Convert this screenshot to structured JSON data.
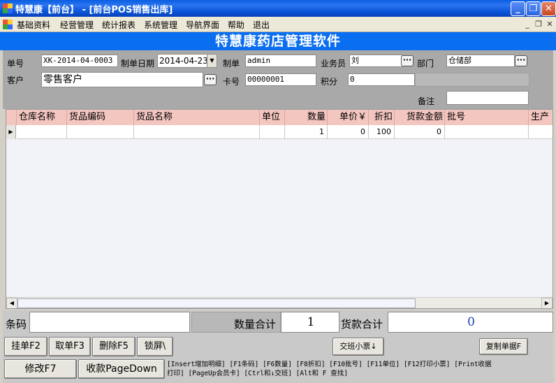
{
  "window": {
    "title": "特慧康【前台】 - [前台POS销售出库]"
  },
  "menu": {
    "items": [
      "基础资料",
      "经营管理",
      "统计报表",
      "系统管理",
      "导航界面",
      "帮助",
      "退出"
    ]
  },
  "banner": {
    "title": "特慧康药店管理软件"
  },
  "form": {
    "order_no_label": "单号",
    "order_no": "XK-2014-04-0003",
    "date_label": "制单日期",
    "date": "2014-04-23",
    "maker_label": "制单",
    "maker": "admin",
    "salesman_label": "业务员",
    "salesman": "刘",
    "dept_label": "部门",
    "dept": "仓储部",
    "customer_label": "客户",
    "customer": "零售客户",
    "card_label": "卡号",
    "card": "00000001",
    "points_label": "积分",
    "points": "0",
    "remark_label": "备注",
    "remark": ""
  },
  "grid": {
    "columns": [
      "仓库名称",
      "货品编码",
      "货品名称",
      "单位",
      "数量",
      "单价￥",
      "折扣",
      "货款金额",
      "批号",
      "生产"
    ],
    "row": {
      "qty": "1",
      "price": "0",
      "discount": "100",
      "amount": "0"
    }
  },
  "bottom": {
    "barcode_label": "条码",
    "barcode": "",
    "qty_total_label": "数量合计",
    "qty_total": "1",
    "amount_total_label": "货款合计",
    "amount_total": "0",
    "buttons": {
      "hold": "挂单F2",
      "fetch": "取单F3",
      "delete": "删除F5",
      "lock": "锁屏\\",
      "shift_ticket": "交班小票↓",
      "copy_receipt": "复制单据F",
      "modify": "修改F7",
      "checkout": "收款PageDown"
    },
    "hotkeys_line1": "[Insert增加明细] [F1条码] [F6数量] [F8折扣] [F10批号] [F11单位] [F12打印小票] [Print收据",
    "hotkeys_line2": "打印] [PageUp会员卡] [Ctrl和↓交班] [Alt和 F 查找]"
  },
  "colors": {
    "title_bar": "#0a55d8",
    "banner": "#0a6ef0",
    "grid_header": "#f4c6c0",
    "total_amount": "#1a3fb0"
  }
}
